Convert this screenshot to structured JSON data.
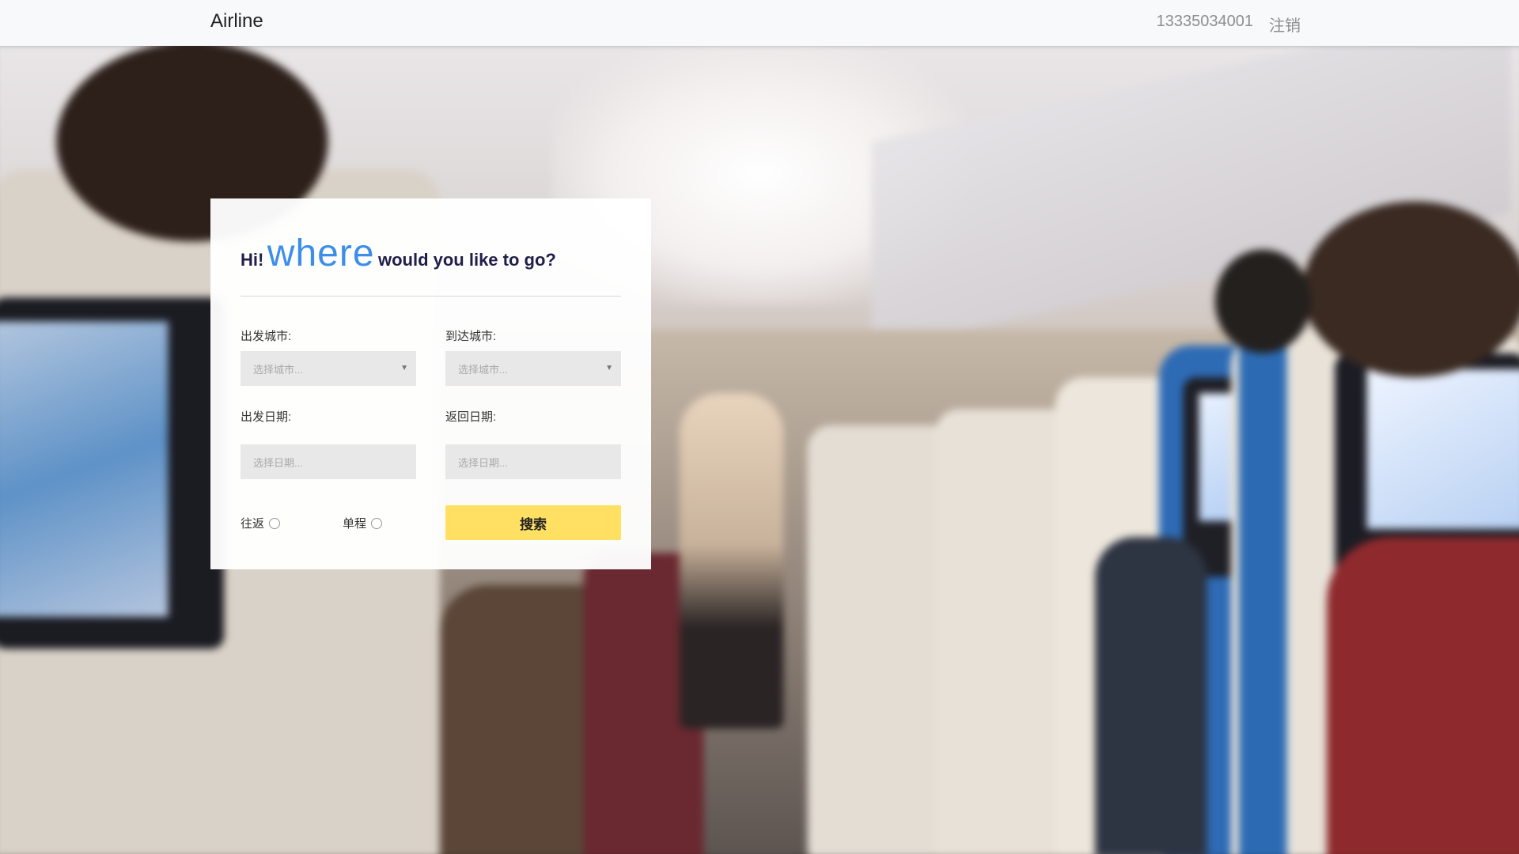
{
  "nav": {
    "brand": "Airline",
    "phone": "13335034001",
    "logout": "注销"
  },
  "form": {
    "heading_hi": "Hi!",
    "heading_where": "where",
    "heading_rest": "would you like to go?",
    "depart_city_label": "出发城市:",
    "arrive_city_label": "到达城市:",
    "depart_city_value": "选择城市...",
    "arrive_city_value": "选择城市...",
    "depart_date_label": "出发日期:",
    "return_date_label": "返回日期:",
    "depart_date_placeholder": "选择日期...",
    "return_date_placeholder": "选择日期...",
    "round_trip_label": "往返",
    "one_way_label": "单程",
    "search_button": "搜索"
  },
  "colors": {
    "accent_blue": "#3d8eea",
    "button_yellow": "#ffe063",
    "navbar_bg": "#f8f9fb"
  }
}
